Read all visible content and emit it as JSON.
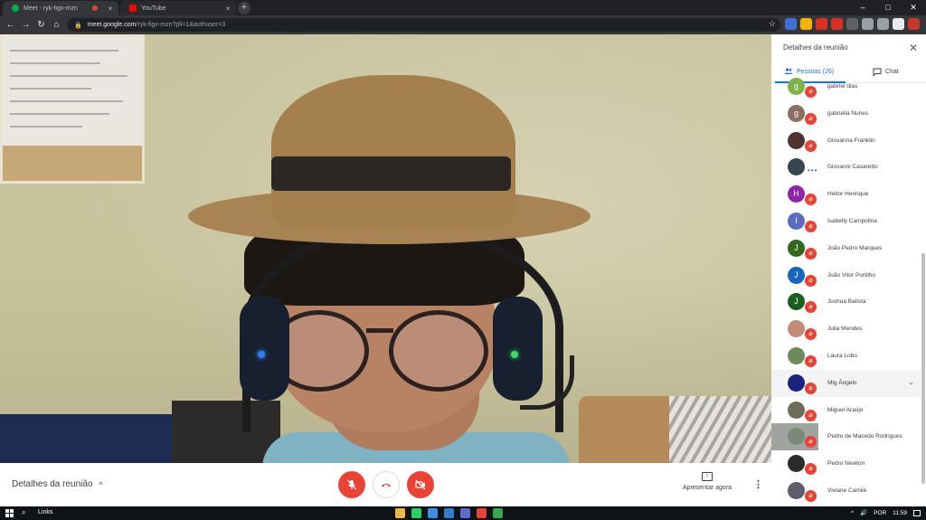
{
  "browser": {
    "tabs": [
      {
        "title": "Meet - ryk-figx-mzn",
        "favicon_color": "#00ac47",
        "recording": true,
        "close": "×"
      },
      {
        "title": "YouTube",
        "favicon_color": "#ff0000",
        "recording": false,
        "close": "×"
      }
    ],
    "new_tab_icon": "plus-icon",
    "new_tab_glyph": "+",
    "window_controls": {
      "minimize": "–",
      "maximize": "□",
      "close": "✕"
    },
    "nav": {
      "back": "←",
      "forward": "→",
      "reload": "↻",
      "home": "⌂"
    },
    "url_host": "meet.google.com",
    "url_path": "/ryk-figx-mzn?pli=1&authuser=3",
    "lock_glyph": "🔒",
    "star_glyph": "☆",
    "extension_colors": [
      "#3e6fd8",
      "#f6b400",
      "#d93025",
      "#d93025",
      "#5f6368",
      "#9aa0a6",
      "#9aa0a6",
      "#e8eaed",
      "#c53929"
    ],
    "menu_glyph": "⋮"
  },
  "controls": {
    "meeting_details_label": "Detalhes da reunião",
    "meeting_details_chevron": "^",
    "mic_icon": "microphone-off-icon",
    "hangup_icon": "phone-hangup-icon",
    "camera_icon": "camera-off-icon",
    "present_label": "Apresentar agora",
    "present_glyph": "↑",
    "more_glyph": "⋮"
  },
  "panel": {
    "title": "Detalhes da reunião",
    "close_glyph": "✕",
    "tab_people": "Pessoas (26)",
    "tab_chat": "Chat",
    "participants": [
      {
        "name": "gabriel dias",
        "initial": "g",
        "color": "#7cb342"
      },
      {
        "name": "gabriella Nunes",
        "initial": "g",
        "color": "#8d6e63"
      },
      {
        "name": "Giovanna Franklin",
        "initial": "",
        "color": "#4e342e"
      },
      {
        "name": "Giovanni Casaretto",
        "initial": "",
        "color": "#37474f",
        "speaking": true
      },
      {
        "name": "Heitor Henrique",
        "initial": "H",
        "color": "#8e24aa"
      },
      {
        "name": "Isabelly Campolina",
        "initial": "I",
        "color": "#5c6bc0"
      },
      {
        "name": "João Pedro Marques",
        "initial": "J",
        "color": "#33691e"
      },
      {
        "name": "João Vitor Portilho",
        "initial": "J",
        "color": "#1565c0"
      },
      {
        "name": "Joshua Batista",
        "initial": "J",
        "color": "#1b5e20"
      },
      {
        "name": "Julia Mendes",
        "initial": "",
        "color": "#c58b7a"
      },
      {
        "name": "Laura Lobo",
        "initial": "",
        "color": "#6d8a5a"
      },
      {
        "name": "Mig Ângelo",
        "initial": "",
        "color": "#1a237e",
        "expanded": true
      },
      {
        "name": "Miguel Araújo",
        "initial": "",
        "color": "#6d6d5a"
      },
      {
        "name": "Pedro de Macedo Rodrigues",
        "initial": "",
        "color": "#7a8a78",
        "pinned": true
      },
      {
        "name": "Pedro Newton",
        "initial": "",
        "color": "#2b2b2b"
      },
      {
        "name": "Viviane Camile",
        "initial": "",
        "color": "#5d5d6b"
      }
    ]
  },
  "taskbar": {
    "links_label": "Links",
    "search_glyph": "⌕",
    "app_colors": [
      "#f3b63f",
      "#25d366",
      "#3a8ee6",
      "#2d7dd2",
      "#5b6bd6",
      "#ea4335",
      "#34a853"
    ],
    "language": "POR",
    "clock": "11:59",
    "tray_up": "^",
    "tray_volume": "🔊"
  }
}
